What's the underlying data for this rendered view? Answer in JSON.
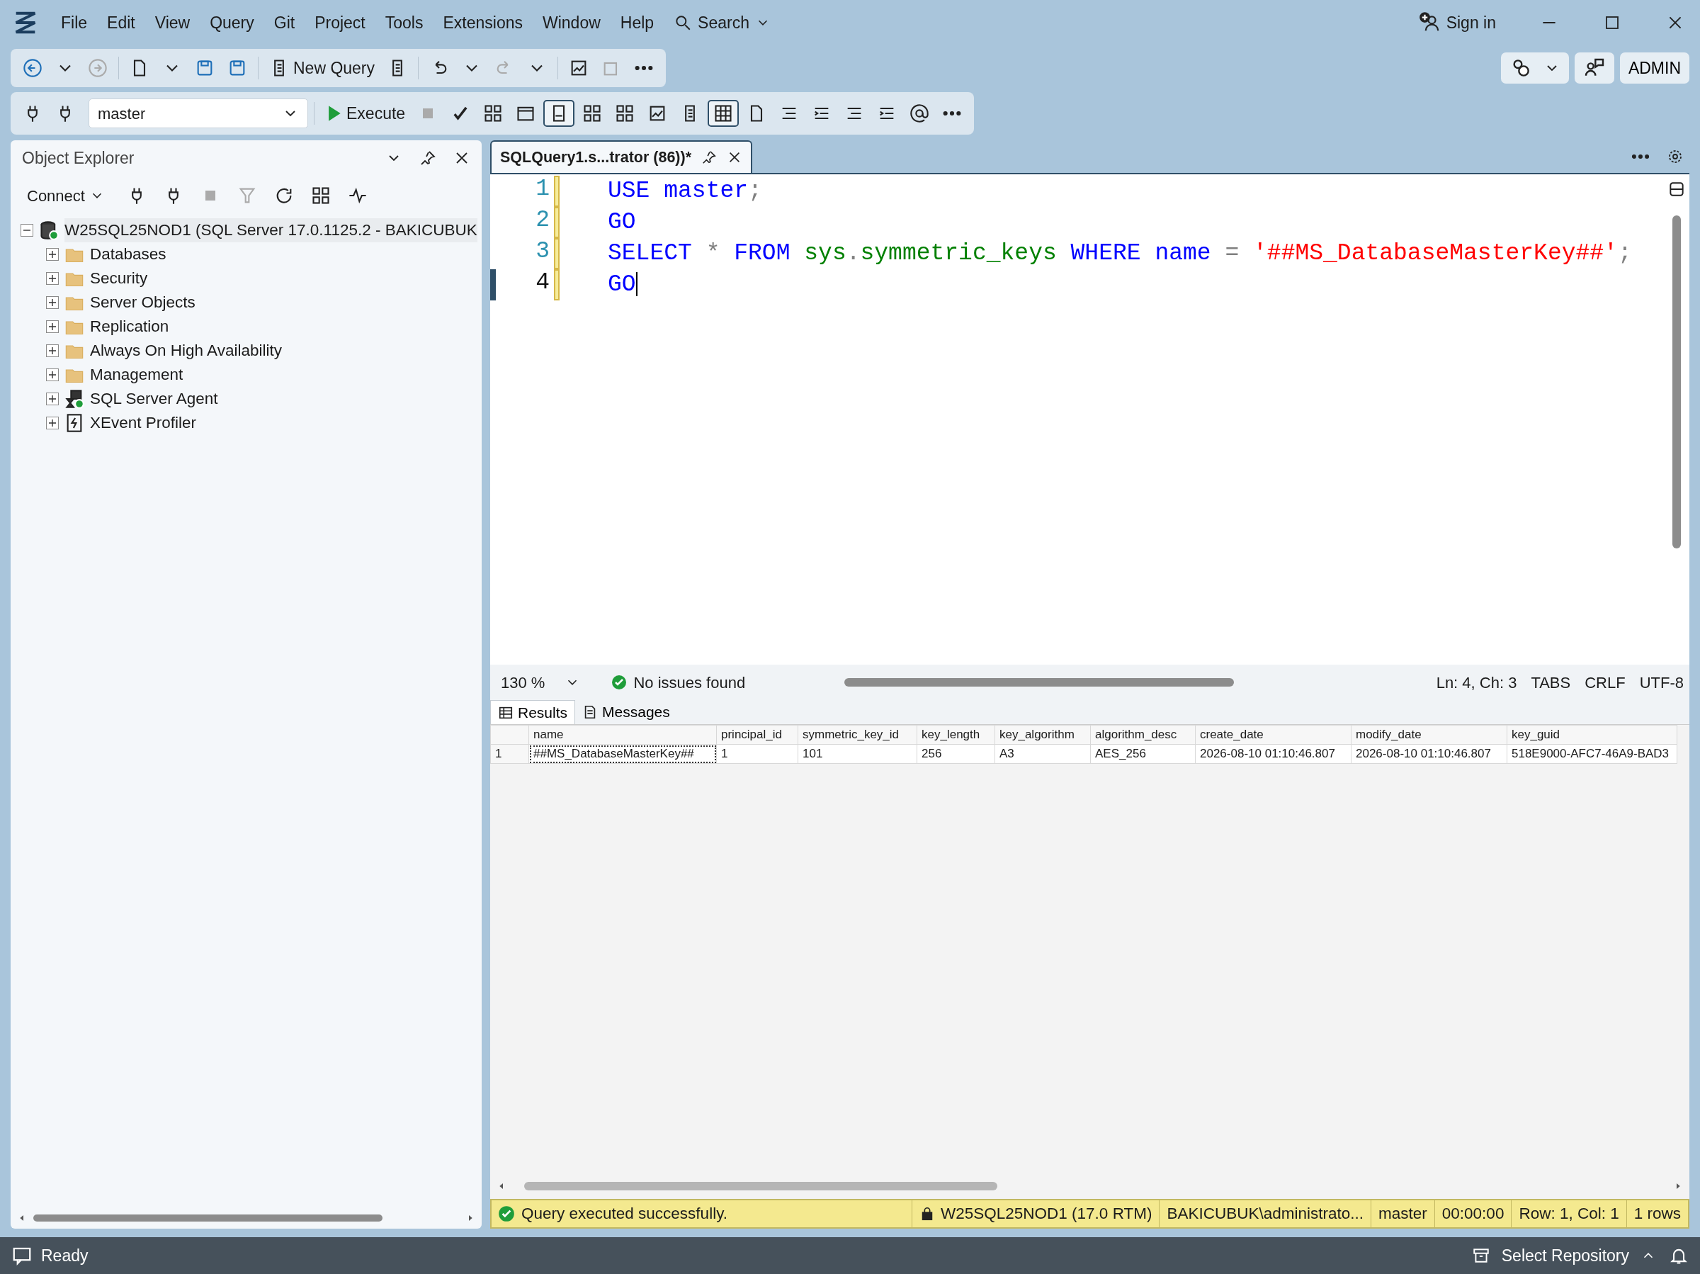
{
  "menu": [
    "File",
    "Edit",
    "View",
    "Query",
    "Git",
    "Project",
    "Tools",
    "Extensions",
    "Window",
    "Help"
  ],
  "search": {
    "label": "Search"
  },
  "account": {
    "sign_in": "Sign in",
    "user": "ADMIN"
  },
  "toolbar_1": {
    "new_query": "New Query"
  },
  "toolbar_2": {
    "database": "master",
    "execute": "Execute",
    "buttons": [
      {
        "selected": false
      },
      {
        "selected": false
      },
      {
        "selected": false
      },
      {
        "selected": false
      },
      {
        "selected": true
      },
      {
        "selected": false
      },
      {
        "selected": false
      },
      {
        "selected": false
      },
      {
        "selected": false
      },
      {
        "selected": true
      },
      {
        "selected": false
      },
      {
        "selected": false
      },
      {
        "selected": false
      },
      {
        "selected": false
      },
      {
        "selected": false
      },
      {
        "selected": false
      },
      {
        "selected": false
      }
    ]
  },
  "object_explorer": {
    "title": "Object Explorer",
    "connect": "Connect",
    "tree": [
      {
        "label": "W25SQL25NOD1 (SQL Server 17.0.1125.2 - BAKICUBUK",
        "kind": "server",
        "expanded": true,
        "children": [
          {
            "label": "Databases",
            "kind": "folder",
            "expanded": false
          },
          {
            "label": "Security",
            "kind": "folder",
            "expanded": false
          },
          {
            "label": "Server Objects",
            "kind": "folder",
            "expanded": false
          },
          {
            "label": "Replication",
            "kind": "folder",
            "expanded": false
          },
          {
            "label": "Always On High Availability",
            "kind": "folder",
            "expanded": false
          },
          {
            "label": "Management",
            "kind": "folder",
            "expanded": false
          },
          {
            "label": "SQL Server Agent",
            "kind": "agent",
            "expanded": false
          },
          {
            "label": "XEvent Profiler",
            "kind": "profiler",
            "expanded": false
          }
        ]
      }
    ]
  },
  "document_tabs": [
    {
      "label": "SQLQuery1.s...trator (86))*",
      "selected": true
    }
  ],
  "editor": {
    "lines": [
      {
        "number": "1",
        "changed": true,
        "current": false,
        "tokens": [
          {
            "kind": "keyword",
            "text": "USE"
          },
          {
            "kind": "keyword",
            "text": " master"
          },
          {
            "kind": "operator",
            "text": ";"
          }
        ]
      },
      {
        "number": "2",
        "changed": true,
        "current": false,
        "tokens": [
          {
            "kind": "keyword",
            "text": "GO"
          }
        ]
      },
      {
        "number": "3",
        "changed": true,
        "current": false,
        "tokens": [
          {
            "kind": "keyword",
            "text": "SELECT"
          },
          {
            "kind": "operator",
            "text": " *"
          },
          {
            "kind": "keyword",
            "text": " FROM"
          },
          {
            "kind": "object",
            "text": " sys"
          },
          {
            "kind": "operator",
            "text": "."
          },
          {
            "kind": "object",
            "text": "symmetric_keys"
          },
          {
            "kind": "keyword",
            "text": " WHERE"
          },
          {
            "kind": "keyword",
            "text": " name"
          },
          {
            "kind": "operator",
            "text": " ="
          },
          {
            "kind": "string",
            "text": " '##MS_DatabaseMasterKey##'"
          },
          {
            "kind": "operator",
            "text": ";"
          }
        ]
      },
      {
        "number": "4",
        "changed": true,
        "current": true,
        "tokens": [
          {
            "kind": "keyword",
            "text": "GO"
          }
        ]
      }
    ],
    "zoom": "130 %",
    "issues": "No issues found",
    "position": "Ln: 4, Ch: 3",
    "indent": "TABS",
    "line_ending": "CRLF",
    "encoding": "UTF-8"
  },
  "result_tabs": [
    {
      "label": "Results",
      "selected": true
    },
    {
      "label": "Messages",
      "selected": false
    }
  ],
  "grid": {
    "columns": [
      "name",
      "principal_id",
      "symmetric_key_id",
      "key_length",
      "key_algorithm",
      "algorithm_desc",
      "create_date",
      "modify_date",
      "key_guid"
    ],
    "rows": [
      {
        "number": "1",
        "cells": [
          {
            "text": "##MS_DatabaseMasterKey##",
            "selected": true
          },
          {
            "text": "1",
            "selected": false
          },
          {
            "text": "101",
            "selected": false
          },
          {
            "text": "256",
            "selected": false
          },
          {
            "text": "A3",
            "selected": false
          },
          {
            "text": "AES_256",
            "selected": false
          },
          {
            "text": "2026-08-10 01:10:46.807",
            "selected": false
          },
          {
            "text": "2026-08-10 01:10:46.807",
            "selected": false
          },
          {
            "text": "518E9000-AFC7-46A9-BAD3",
            "selected": false
          }
        ]
      }
    ]
  },
  "query_status": {
    "message": "Query executed successfully.",
    "server": "W25SQL25NOD1 (17.0 RTM)",
    "user": "BAKICUBUK\\administrato...",
    "database": "master",
    "elapsed": "00:00:00",
    "cursor": "Row: 1, Col: 1",
    "rows": "1 rows"
  },
  "status_bar": {
    "state": "Ready",
    "repository": "Select Repository"
  }
}
